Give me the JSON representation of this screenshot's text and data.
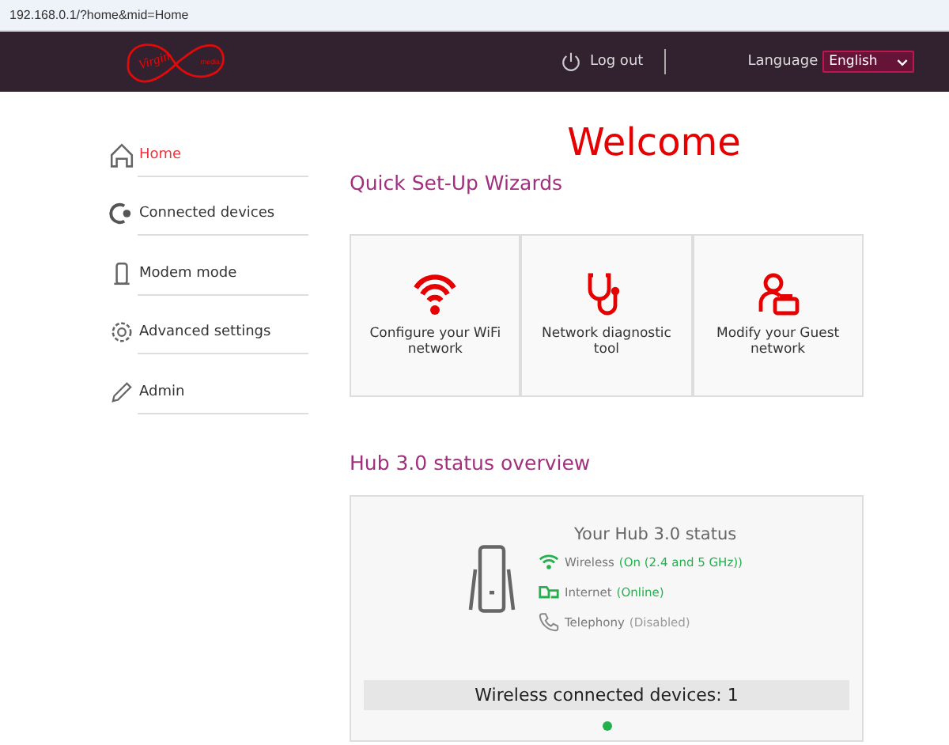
{
  "address_bar": {
    "url": "192.168.0.1/?home&mid=Home"
  },
  "header": {
    "logo": {
      "wordmark": "Virgin",
      "sub": "media"
    },
    "logout": "Log out",
    "language_label": "Language",
    "language": "English"
  },
  "sidebar": {
    "items": [
      {
        "label": "Home",
        "kind": "home",
        "selected": true
      },
      {
        "label": "Connected devices",
        "kind": "devices",
        "selected": false
      },
      {
        "label": "Modem mode",
        "kind": "modem",
        "selected": false
      },
      {
        "label": "Advanced settings",
        "kind": "settings",
        "selected": false
      },
      {
        "label": "Admin",
        "kind": "admin",
        "selected": false
      }
    ]
  },
  "main": {
    "title": "Welcome",
    "wizards_heading": "Quick Set-Up Wizards",
    "wizards": [
      {
        "label": "Configure your WiFi network",
        "kind": "wifi"
      },
      {
        "label": "Network diagnostic tool",
        "kind": "stethoscope"
      },
      {
        "label": "Modify your Guest network",
        "kind": "guest"
      }
    ],
    "status_heading": "Hub 3.0 status overview",
    "status": {
      "title": "Your Hub 3.0 status",
      "items": [
        {
          "label": "Wireless",
          "value": "(On (2.4 and 5 GHz))",
          "kind": "wifi",
          "active": true
        },
        {
          "label": "Internet",
          "value": "(Online)",
          "kind": "internet",
          "active": true
        },
        {
          "label": "Telephony",
          "value": "(Disabled)",
          "kind": "phone",
          "active": false
        }
      ],
      "devices_bar": "Wireless connected devices: 1"
    }
  }
}
